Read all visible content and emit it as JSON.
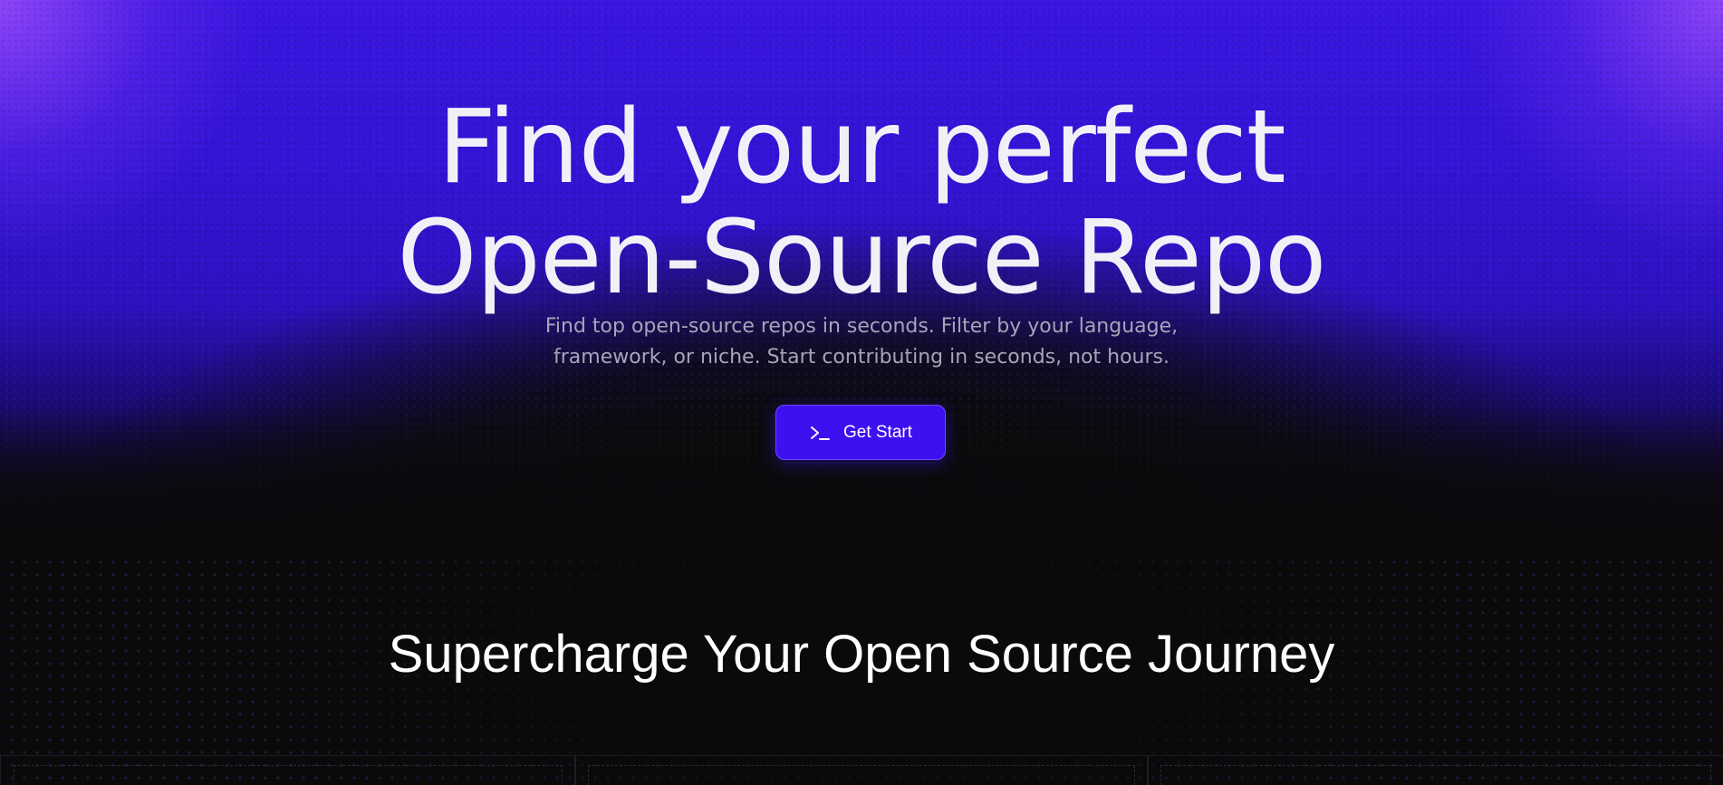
{
  "hero": {
    "title_line1": "Find your perfect",
    "title_line2": "Open-Source Repo",
    "subtitle": "Find top open-source repos in seconds. Filter by your language, framework, or niche. Start contributing in seconds, not hours.",
    "cta": {
      "icon": "terminal-icon",
      "label": "Get Start"
    }
  },
  "features": {
    "title": "Supercharge Your Open Source Journey"
  },
  "colors": {
    "accent": "#3d10ef",
    "hero_purple": "#3414d6",
    "background": "#0a0a0b",
    "text_primary": "#f2f0f7",
    "text_muted": "#a8a4b8"
  }
}
